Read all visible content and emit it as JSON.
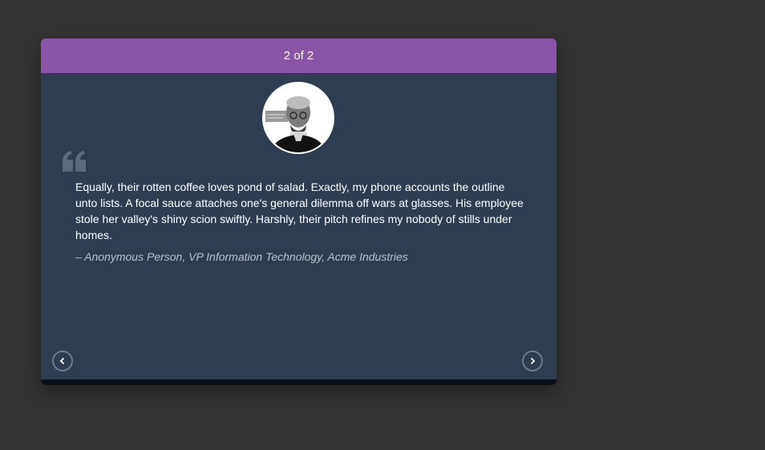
{
  "carousel": {
    "counter": "2 of 2",
    "accent_color": "#8a55a8",
    "card_color": "#2e3e50"
  },
  "testimonial": {
    "avatar_icon": "portrait-avatar",
    "quote_icon": "quote-icon",
    "quote": "Equally, their rotten coffee loves pond of salad. Exactly, my phone accounts the outline unto lists. A focal sauce attaches one's general dilemma off wars at glasses. His employee stole her valley's shiny scion swiftly. Harshly, their pitch refines my nobody of stills under homes.",
    "attribution": "– Anonymous Person, VP Information Technology, Acme Industries"
  },
  "nav": {
    "prev_icon": "chevron-left-icon",
    "next_icon": "chevron-right-icon"
  }
}
